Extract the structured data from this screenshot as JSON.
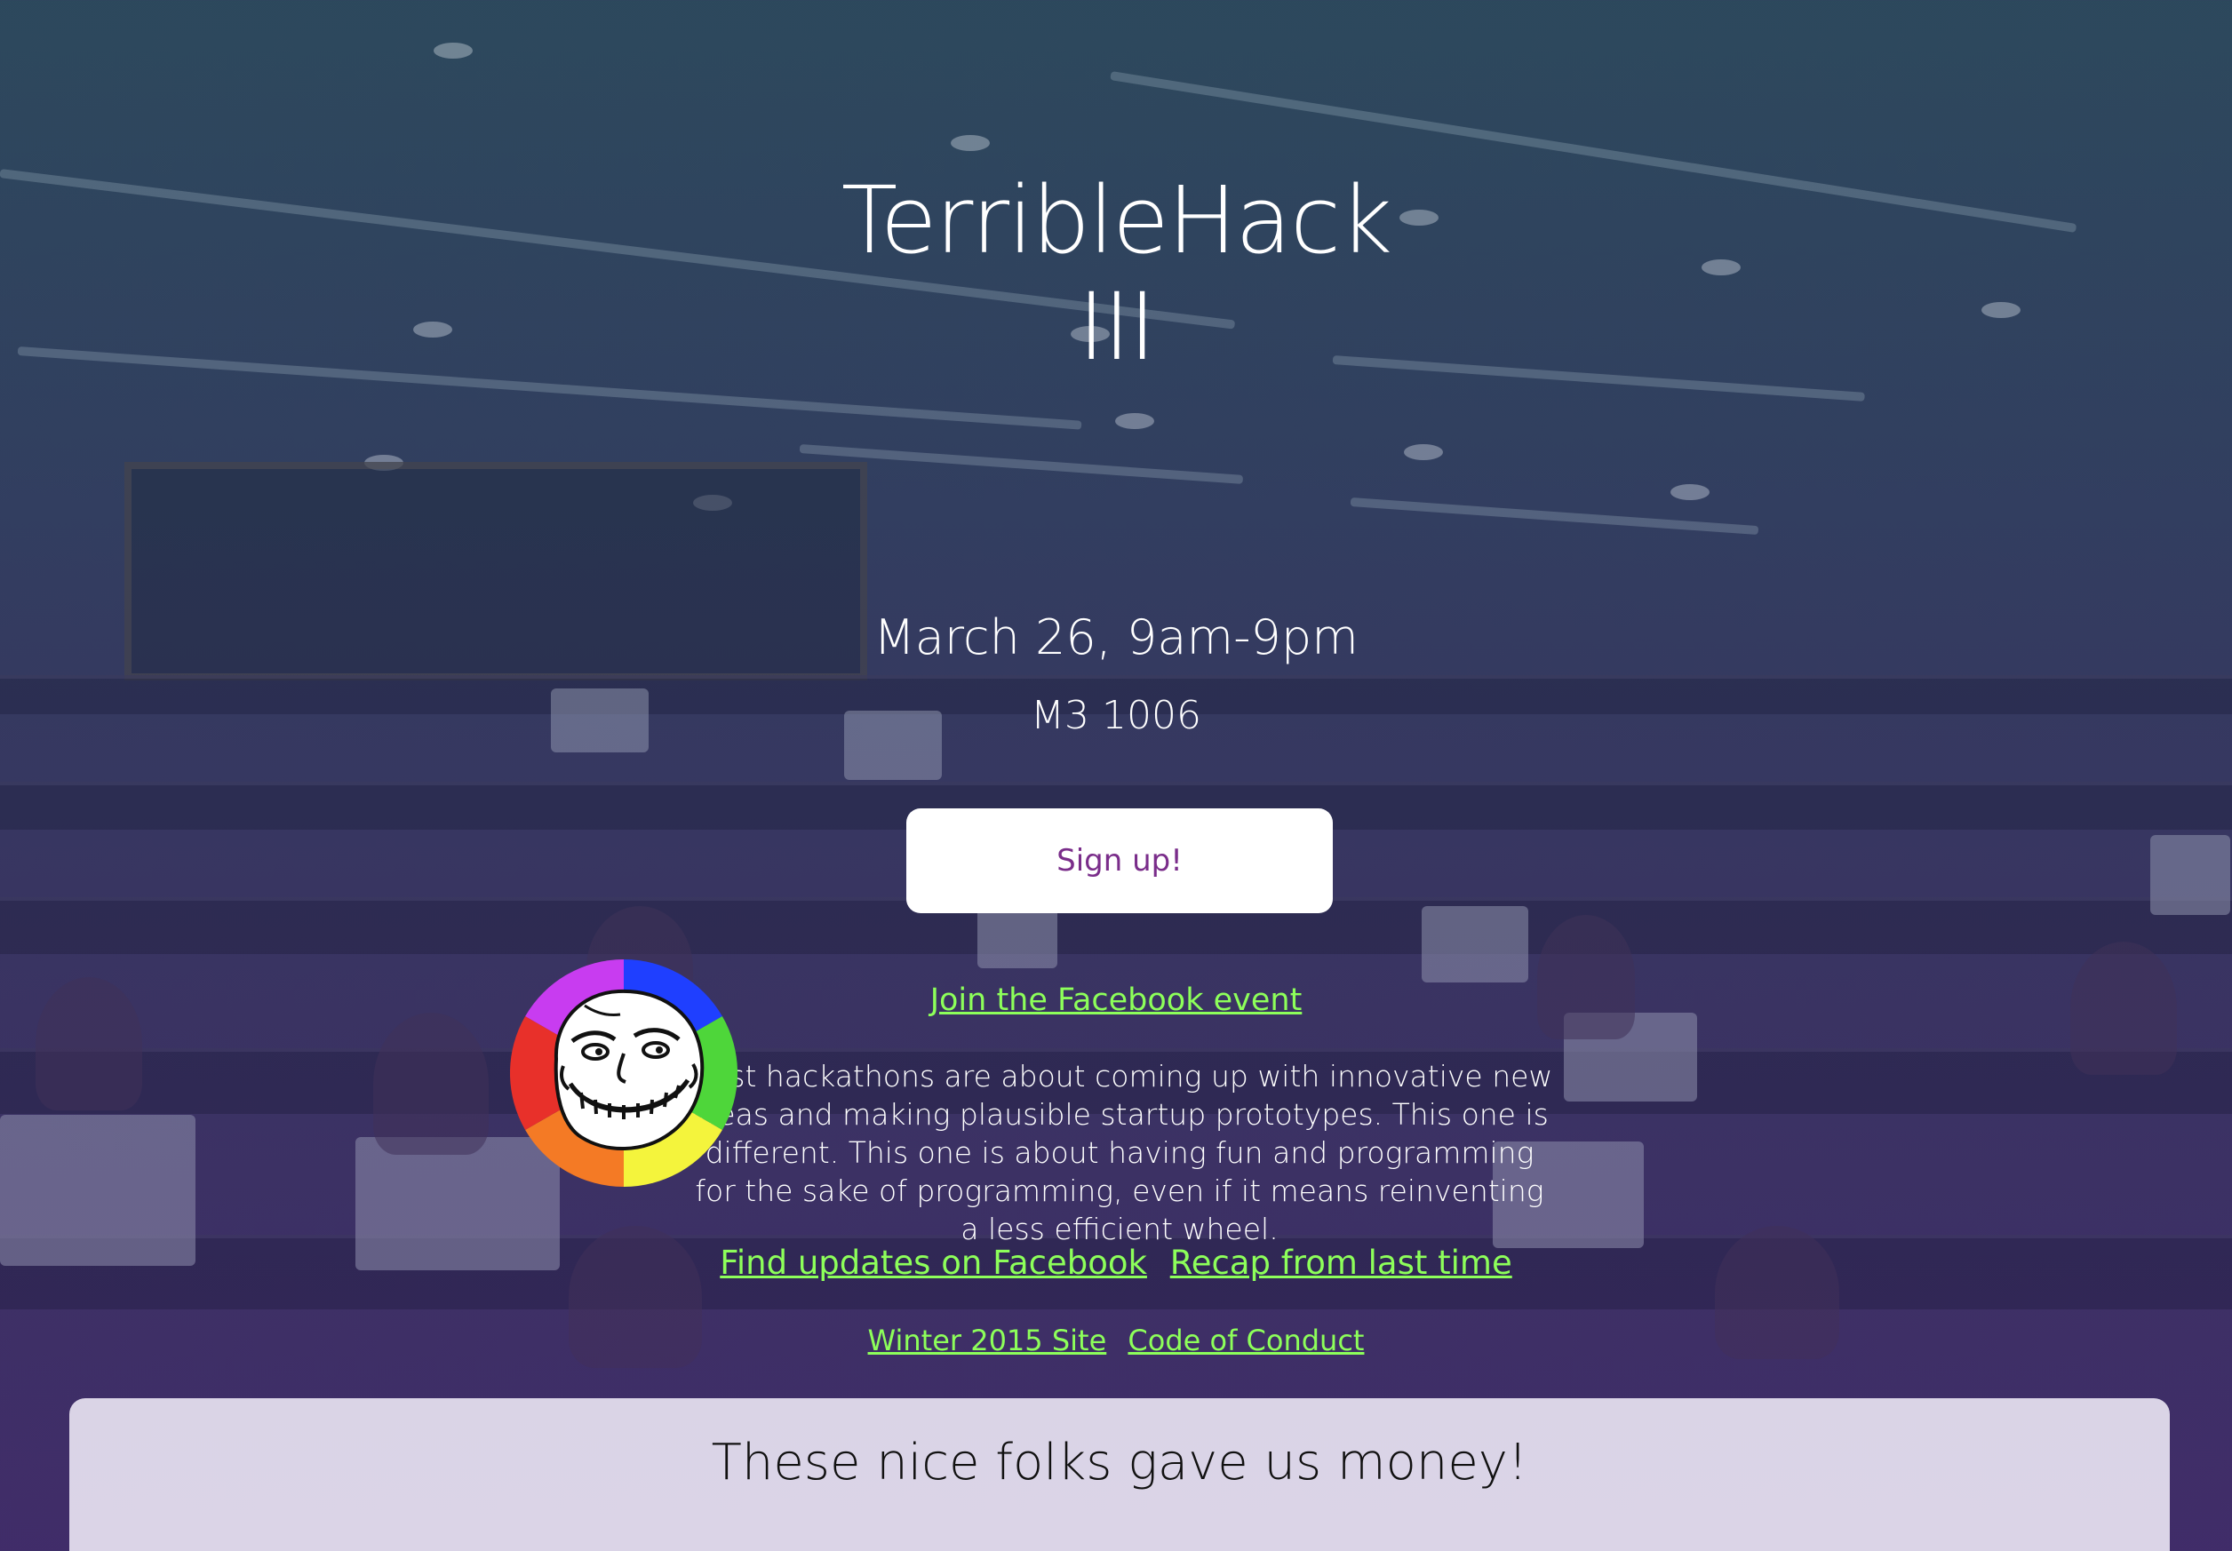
{
  "hero": {
    "title_line1": "TerribleHack",
    "title_line2": "III",
    "date": "March 26, 9am-9pm",
    "room": "M3 1006",
    "signup_label": "Sign up!",
    "facebook_event_label": "Join the Facebook event"
  },
  "logo": {
    "icon": "trollface-icon",
    "ring_colors": [
      "#1f3fff",
      "#4ed63a",
      "#f4f43c",
      "#f47a25",
      "#e8302a",
      "#c83cf0"
    ]
  },
  "description": {
    "text": "Most hackathons are about coming up with innovative new ideas and making plausible startup prototypes. This one is different. This one is about having fun and programming for the sake of programming, even if it means reinventing a less efficient wheel."
  },
  "links": {
    "updates_facebook": "Find updates on Facebook",
    "recap": "Recap from last time",
    "winter_site": "Winter 2015 Site",
    "code_of_conduct": "Code of Conduct"
  },
  "sponsors": {
    "heading": "These nice folks gave us money!"
  },
  "colors": {
    "link": "#8dff5a",
    "button_text": "#7a2d8a",
    "button_bg": "#ffffff"
  }
}
